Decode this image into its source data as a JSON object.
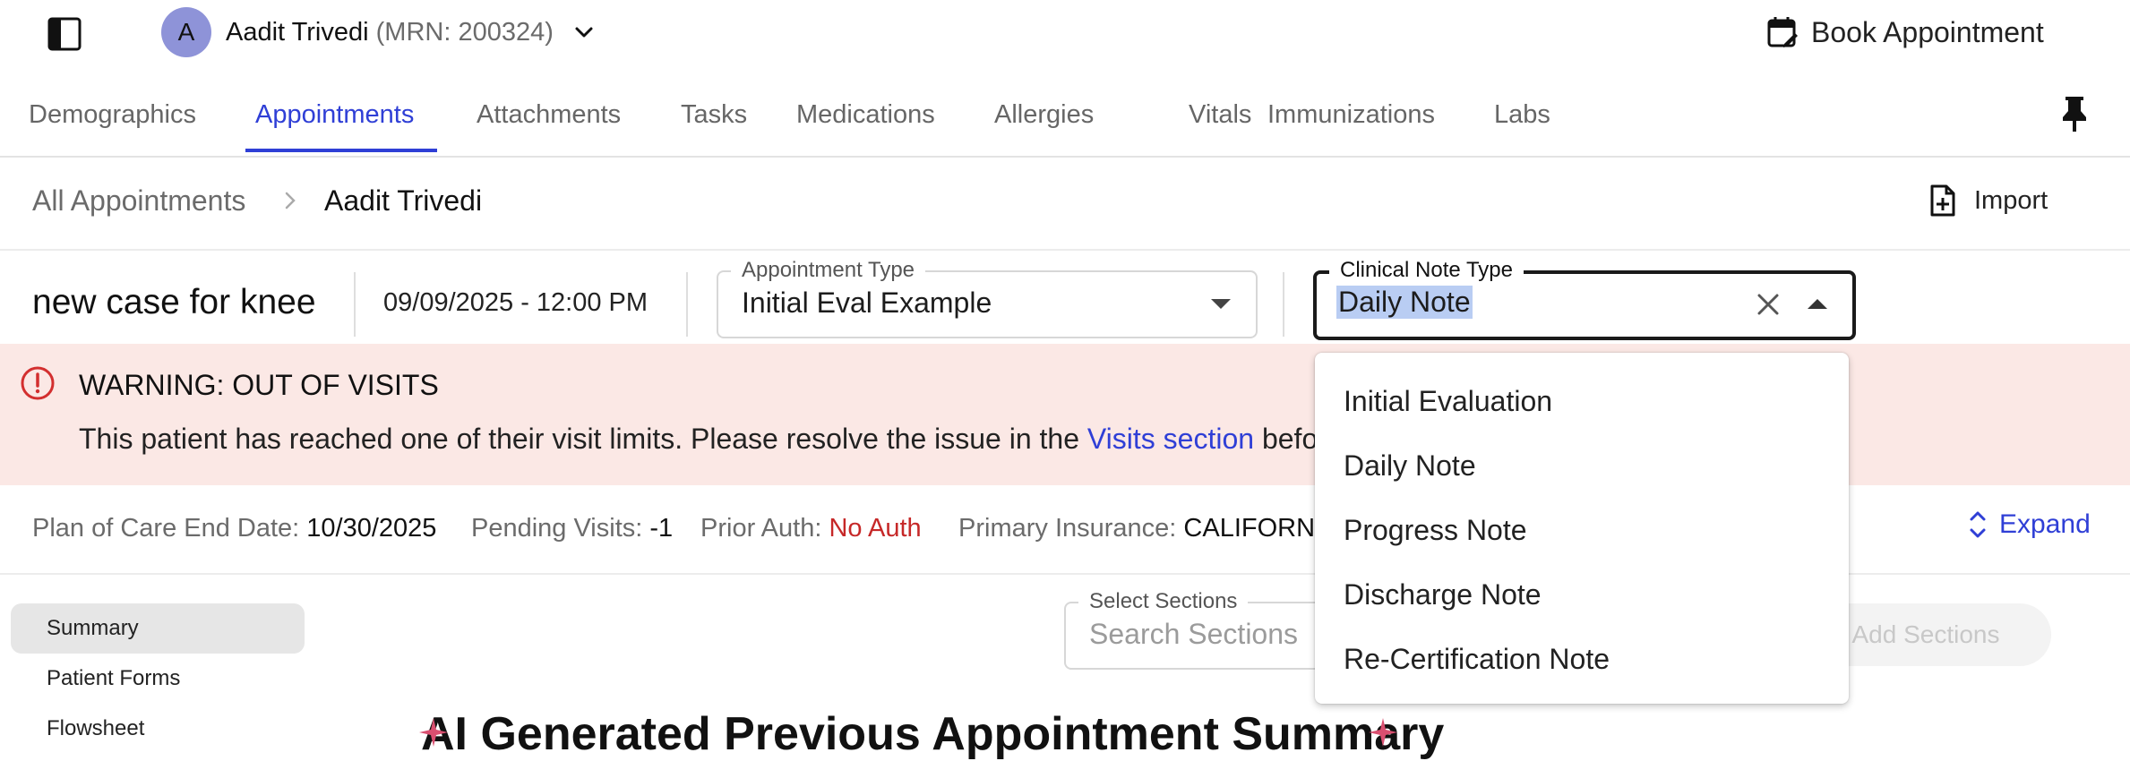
{
  "header": {
    "avatar_initial": "A",
    "patient_name": "Aadit Trivedi",
    "patient_mrn": "(MRN: 200324)",
    "book_appointment_label": "Book Appointment"
  },
  "tabs": [
    {
      "label": "Demographics"
    },
    {
      "label": "Appointments",
      "active": true
    },
    {
      "label": "Attachments"
    },
    {
      "label": "Tasks"
    },
    {
      "label": "Medications"
    },
    {
      "label": "Allergies"
    },
    {
      "label": "Vitals"
    },
    {
      "label": "Immunizations"
    },
    {
      "label": "Labs"
    }
  ],
  "breadcrumb": {
    "parent": "All Appointments",
    "current": "Aadit Trivedi",
    "import_label": "Import"
  },
  "appointment": {
    "title": "new case for knee",
    "datetime": "09/09/2025 - 12:00 PM",
    "type_label": "Appointment Type",
    "type_value": "Initial Eval Example",
    "clinical_note_label": "Clinical Note Type",
    "clinical_note_value": "Daily Note"
  },
  "warning": {
    "title": "WARNING: OUT OF VISITS",
    "body_before": "This patient has reached one of their visit limits. Please resolve the issue in the ",
    "link": "Visits section",
    "body_after": " before"
  },
  "info": {
    "plan_label": "Plan of Care End Date:",
    "plan_value": "10/30/2025",
    "pending_label": "Pending Visits:",
    "pending_value": "-1",
    "auth_label": "Prior Auth:",
    "auth_value": "No Auth",
    "insurance_label": "Primary Insurance:",
    "insurance_value": "CALIFORNI",
    "expand_label": "Expand"
  },
  "left_nav": [
    {
      "label": "Summary",
      "active": true
    },
    {
      "label": "Patient Forms"
    },
    {
      "label": "Flowsheet"
    }
  ],
  "sections": {
    "label": "Select Sections",
    "placeholder": "Search Sections",
    "add_label": "Add Sections"
  },
  "ai_heading": "AI Generated Previous Appointment Summary",
  "dropdown_options": [
    "Initial Evaluation",
    "Daily Note",
    "Progress Note",
    "Discharge Note",
    "Re-Certification Note"
  ],
  "colors": {
    "accent": "#2f3fd6",
    "warning_bg": "#fbe8e5",
    "error": "#c62828",
    "avatar": "#8e93d8",
    "selection": "#b9cdf3"
  },
  "icons": [
    "sidebar-toggle-icon",
    "chevron-down-icon",
    "calendar-edit-icon",
    "pin-icon",
    "chevron-right-icon",
    "file-plus-icon",
    "close-icon",
    "alert-circle-icon",
    "unfold-icon",
    "sparkle-icon"
  ]
}
